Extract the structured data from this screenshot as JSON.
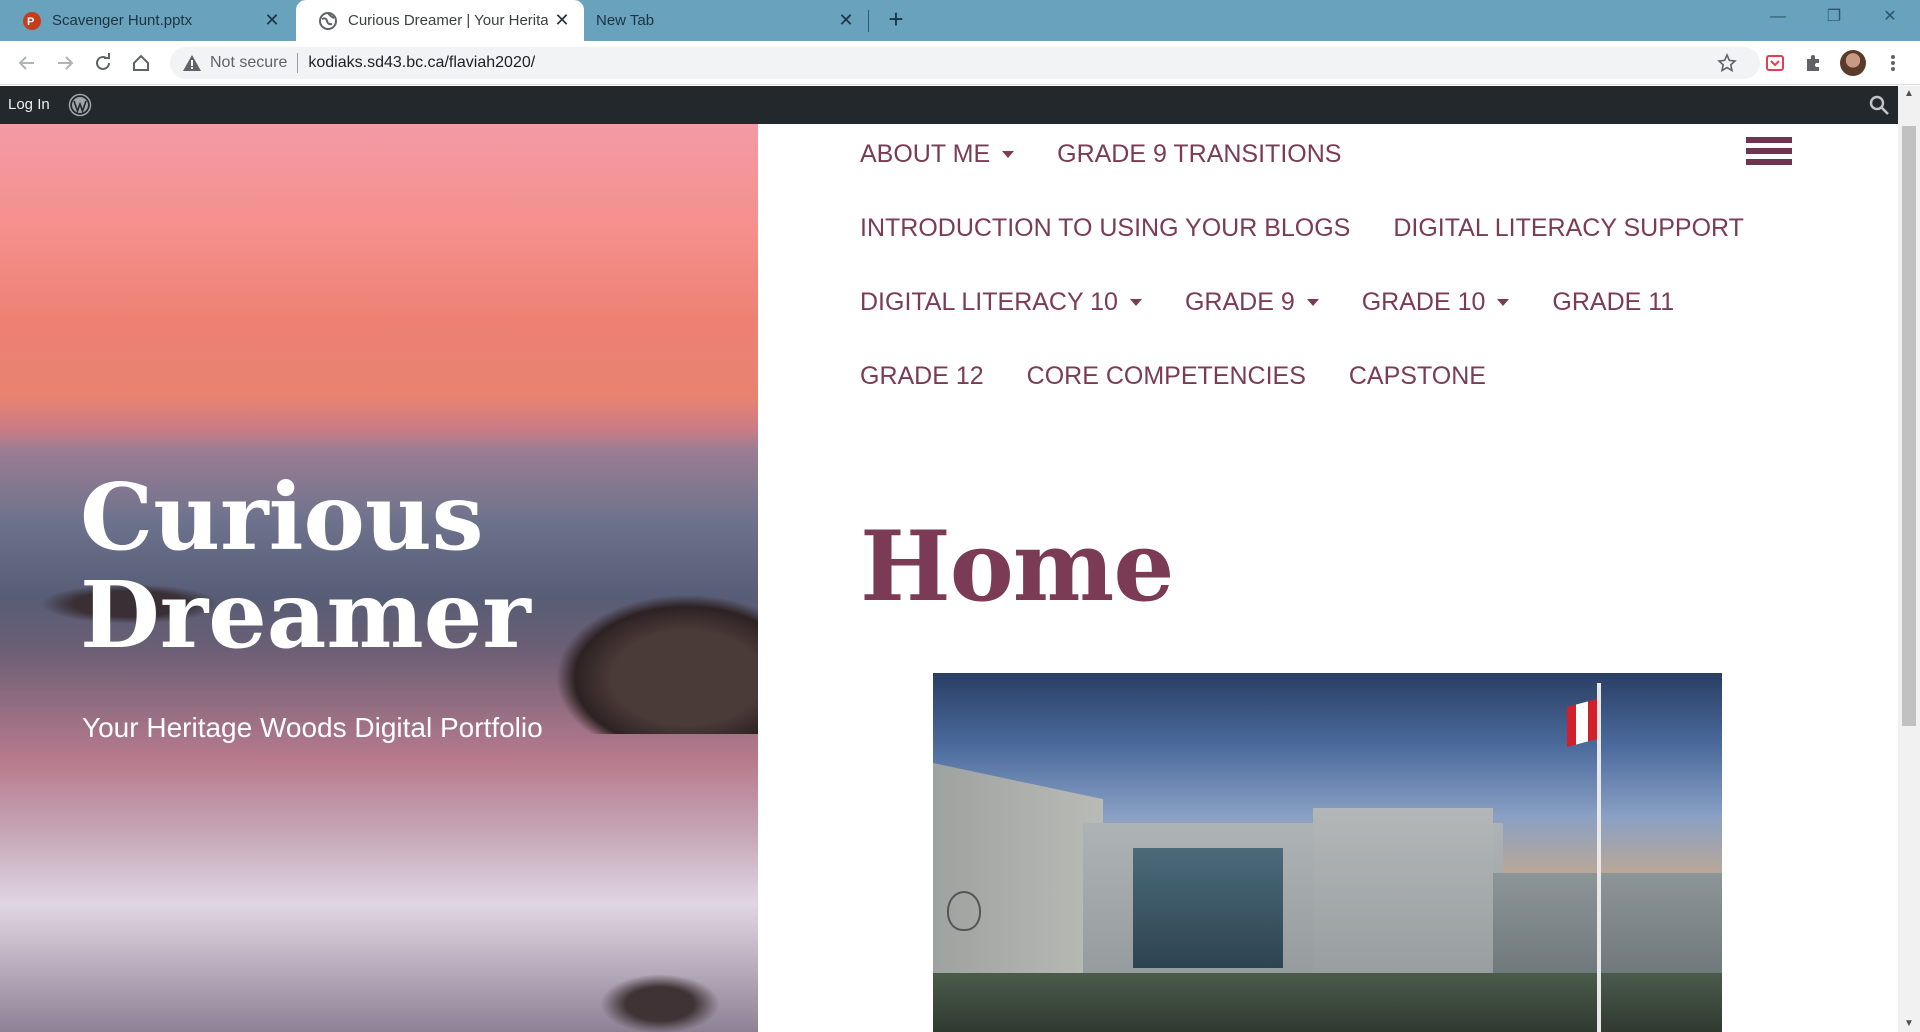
{
  "browser": {
    "tabs": [
      {
        "title": "Scavenger Hunt.pptx",
        "favicon": "powerpoint-icon",
        "active": false
      },
      {
        "title": "Curious Dreamer | Your Heritage",
        "favicon": "globe-icon",
        "active": true
      },
      {
        "title": "New Tab",
        "favicon": "",
        "active": false
      }
    ],
    "security_label": "Not secure",
    "url": "kodiaks.sd43.bc.ca/flaviah2020/"
  },
  "adminbar": {
    "login_label": "Log In"
  },
  "site": {
    "title_line1": "Curious",
    "title_line2": "Dreamer",
    "tagline": "Your Heritage Woods Digital Portfolio"
  },
  "nav": {
    "rows": [
      [
        {
          "label": "ABOUT ME",
          "dropdown": true
        },
        {
          "label": "GRADE 9 TRANSITIONS",
          "dropdown": false
        }
      ],
      [
        {
          "label": "INTRODUCTION TO USING YOUR BLOGS",
          "dropdown": false
        },
        {
          "label": "DIGITAL LITERACY SUPPORT",
          "dropdown": false
        }
      ],
      [
        {
          "label": "DIGITAL LITERACY 10",
          "dropdown": true
        },
        {
          "label": "GRADE 9",
          "dropdown": true
        },
        {
          "label": "GRADE 10",
          "dropdown": true
        },
        {
          "label": "GRADE 11",
          "dropdown": false
        }
      ],
      [
        {
          "label": "GRADE 12",
          "dropdown": false
        },
        {
          "label": "CORE COMPETENCIES",
          "dropdown": false
        },
        {
          "label": "CAPSTONE",
          "dropdown": false
        }
      ]
    ]
  },
  "page": {
    "title": "Home"
  },
  "colors": {
    "accent": "#7b3b55",
    "tabstrip": "#68a2bd",
    "adminbar": "#23282d"
  }
}
